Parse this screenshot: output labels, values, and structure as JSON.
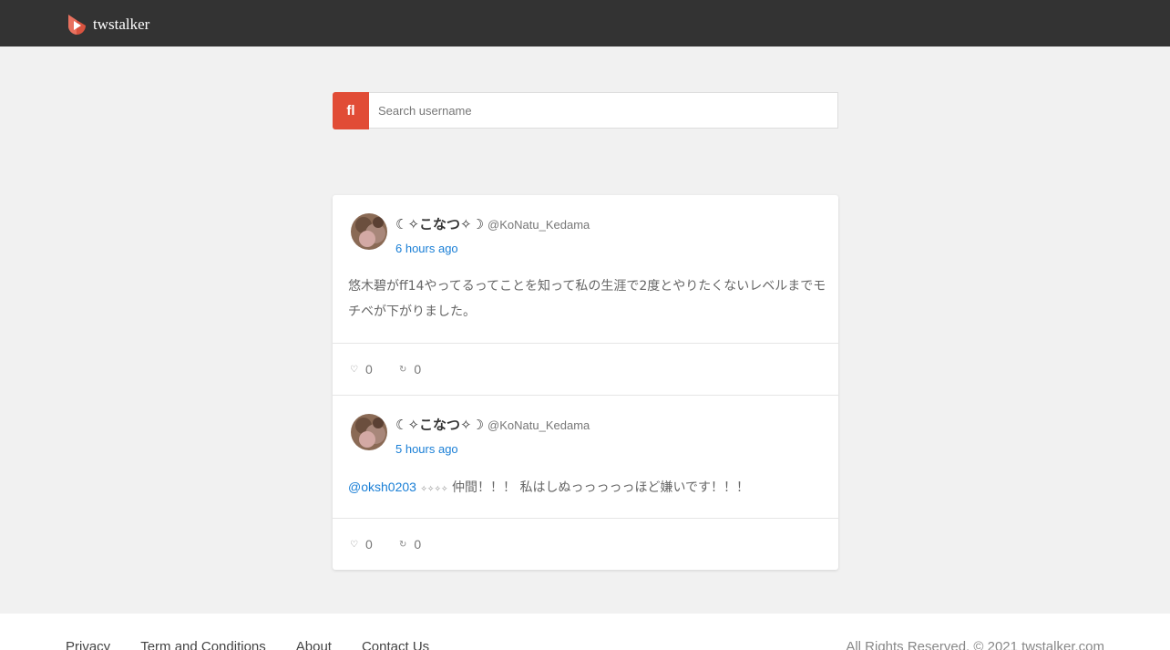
{
  "header": {
    "brand_name": "twstalker",
    "brand_color": "#e8715f",
    "background": "#333333"
  },
  "search": {
    "button_icon": "search-icon",
    "button_glyph": "ﬂ",
    "placeholder": "Search username",
    "value": ""
  },
  "tweets": [
    {
      "display_name": "☾✧こなつ✧☽",
      "handle": "@KoNatu_Kedama",
      "time": "6 hours ago",
      "text": "悠木碧がff14やってるってことを知って私の生涯で2度とやりたくないレベルまでモチベが下がりました。",
      "likes": "0",
      "retweets": "0"
    },
    {
      "display_name": "☾✧こなつ✧☽",
      "handle": "@KoNatu_Kedama",
      "time": "5 hours ago",
      "mention": "@oksh0203",
      "glyphs": "✧✧✧✧",
      "text": "仲間！！！ 私はしぬっっっっっほど嫌いです！！！",
      "likes": "0",
      "retweets": "0"
    }
  ],
  "footer": {
    "links": [
      "Privacy",
      "Term and Conditions",
      "About",
      "Contact Us"
    ],
    "copyright": "All Rights Reserved. © 2021 twstalker.com"
  },
  "colors": {
    "accent": "#e14c36",
    "link": "#1a7fd6",
    "page_bg": "#f1f1f1"
  }
}
